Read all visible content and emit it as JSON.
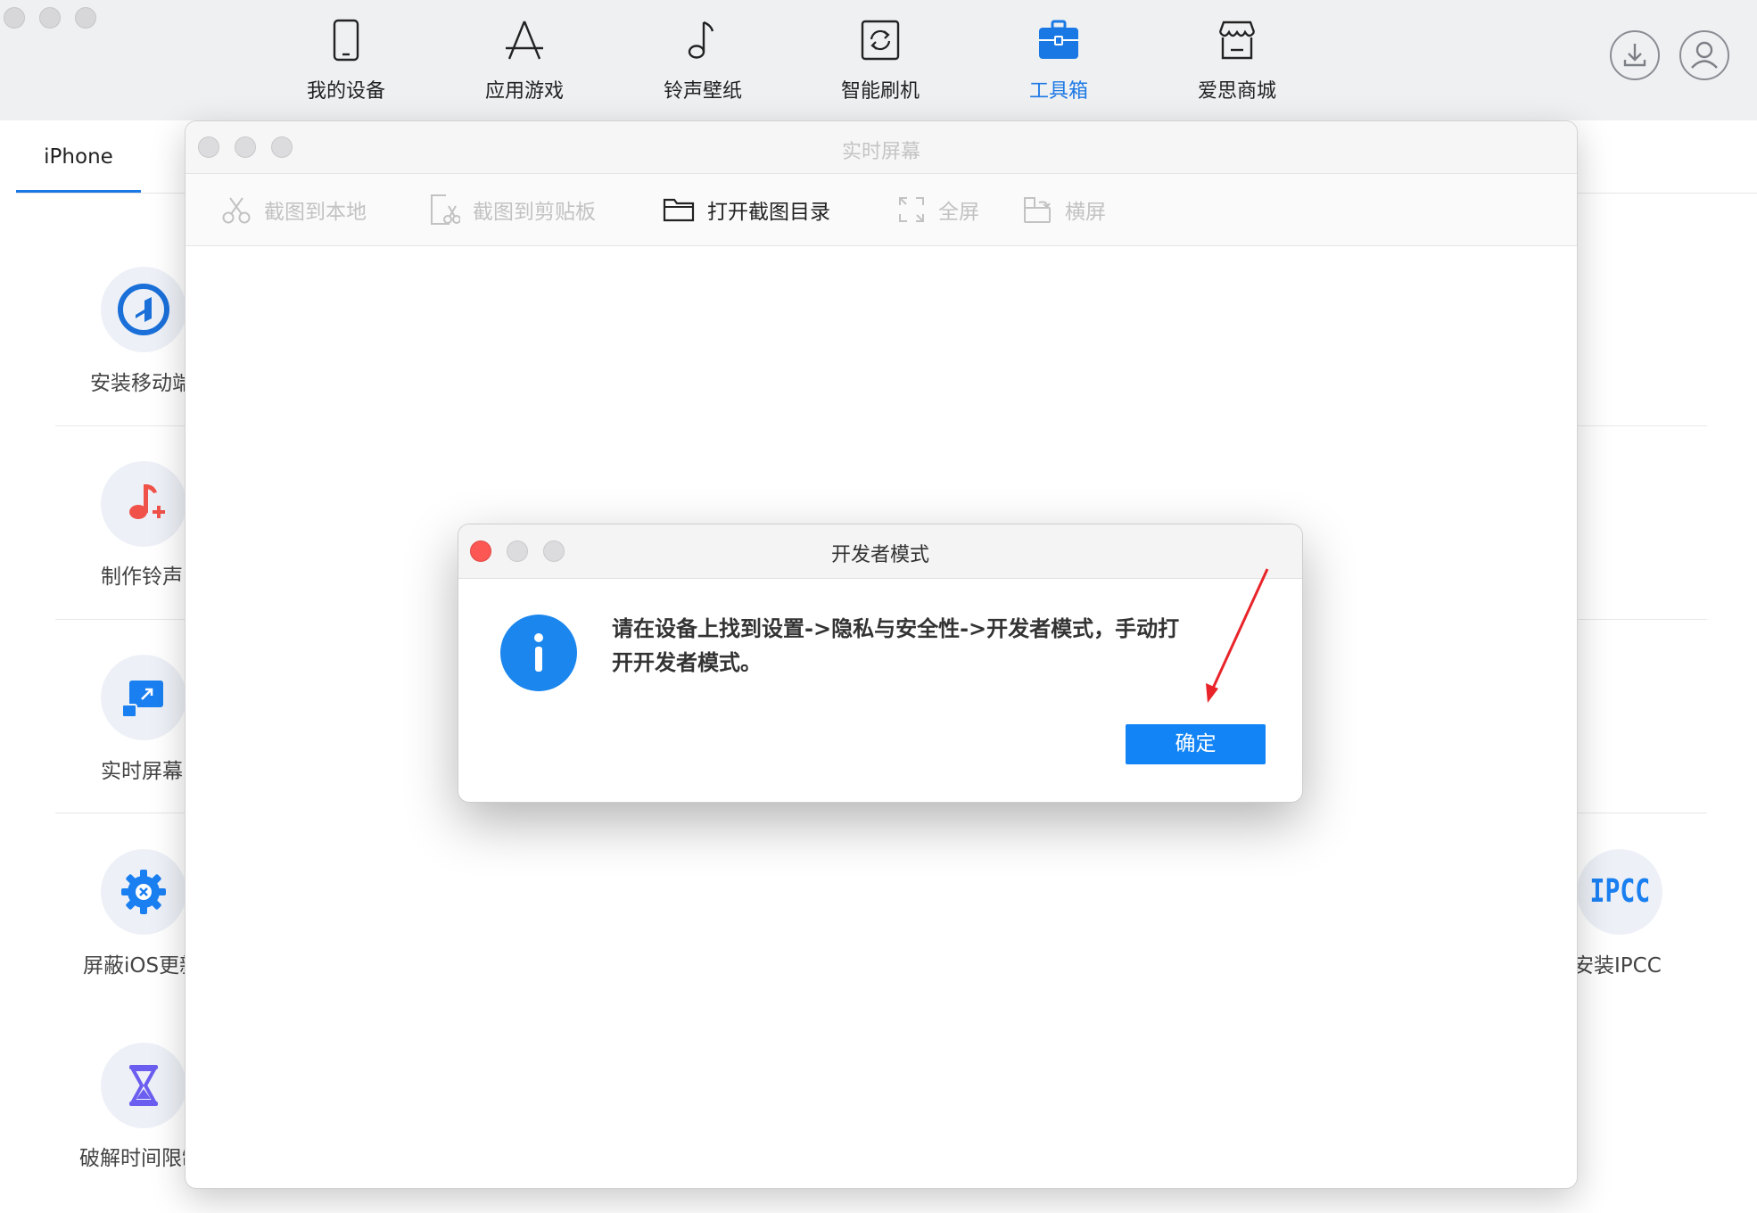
{
  "nav": {
    "items": [
      {
        "label": "我的设备",
        "icon": "phone-icon"
      },
      {
        "label": "应用游戏",
        "icon": "app-store-icon"
      },
      {
        "label": "铃声壁纸",
        "icon": "music-note-icon"
      },
      {
        "label": "智能刷机",
        "icon": "flash-icon"
      },
      {
        "label": "工具箱",
        "icon": "toolbox-icon",
        "active": true
      },
      {
        "label": "爱思商城",
        "icon": "store-icon"
      }
    ],
    "active_color": "#1a78e5"
  },
  "tabs": {
    "device": "iPhone"
  },
  "tools": [
    {
      "label": "安装移动端",
      "icon": "mobile-app-icon"
    },
    {
      "label": "制作铃声",
      "icon": "ringtone-icon"
    },
    {
      "label": "实时屏幕",
      "icon": "screen-mirror-icon"
    },
    {
      "label": "屏蔽iOS更新",
      "icon": "settings-block-icon"
    },
    {
      "label": "破解时间限制",
      "icon": "hourglass-icon"
    },
    {
      "label": "安装IPCC",
      "icon": "ipcc-icon"
    }
  ],
  "ipcc_text": "IPCC",
  "screen_window": {
    "title": "实时屏幕",
    "toolbar": {
      "screenshot_local": "截图到本地",
      "screenshot_clipboard": "截图到剪贴板",
      "open_folder": "打开截图目录",
      "fullscreen": "全屏",
      "landscape": "横屏"
    }
  },
  "dialog": {
    "title": "开发者模式",
    "message_line1": "请在设备上找到设置->隐私与安全性->开发者模式，手动打",
    "message_line2": "开开发者模式。",
    "ok_label": "确定",
    "icon": "info-icon",
    "accent": "#1284f5"
  },
  "annotation_color": "#e8242a"
}
